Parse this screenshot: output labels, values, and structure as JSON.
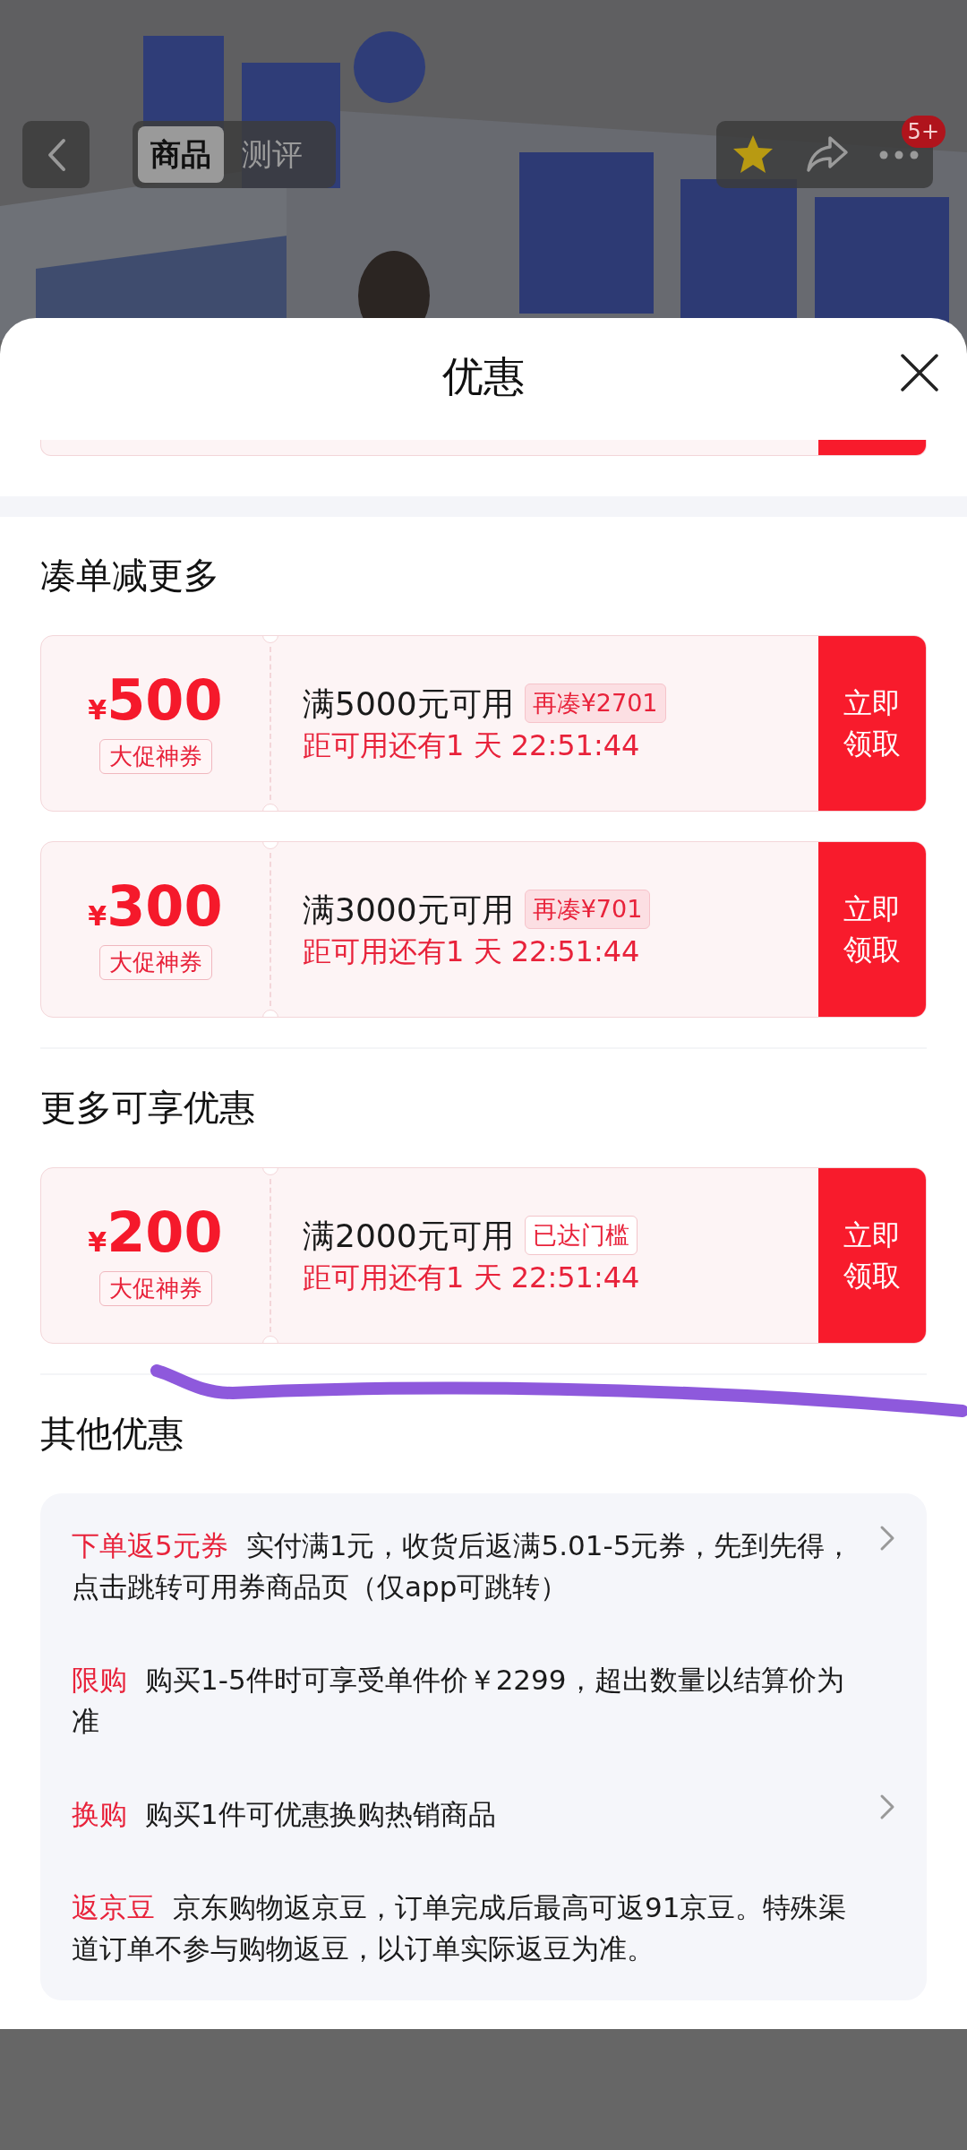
{
  "top_bar": {
    "back": {
      "kind": "back"
    },
    "tabs": [
      {
        "label": "商品",
        "selected": true
      },
      {
        "label": "测评",
        "selected": false
      }
    ],
    "actions": [
      {
        "kind": "star"
      },
      {
        "kind": "share"
      },
      {
        "kind": "more"
      }
    ],
    "badge": "5+"
  },
  "sheet": {
    "title": "优惠",
    "sections": [
      {
        "heading": "凑单减更多",
        "coupons": [
          {
            "currency": "¥",
            "amount": "500",
            "type": "大促神券",
            "condition": "满5000元可用",
            "tag": "再凑¥2701",
            "threshold_met": false,
            "countdown": "距可用还有1 天 22:51:44",
            "button": "立即领取"
          },
          {
            "currency": "¥",
            "amount": "300",
            "type": "大促神券",
            "condition": "满3000元可用",
            "tag": "再凑¥701",
            "threshold_met": false,
            "countdown": "距可用还有1 天 22:51:44",
            "button": "立即领取"
          }
        ]
      },
      {
        "heading": "更多可享优惠",
        "coupons": [
          {
            "currency": "¥",
            "amount": "200",
            "type": "大促神券",
            "condition": "满2000元可用",
            "tag": "已达门槛",
            "threshold_met": true,
            "countdown": "距可用还有1 天 22:51:44",
            "button": "立即领取"
          }
        ]
      }
    ],
    "other": {
      "heading": "其他优惠",
      "items": [
        {
          "label": "下单返5元券",
          "text": "实付满1元，收货后返满5.01-5元券，先到先得，点击跳转可用券商品页（仅app可跳转）",
          "has_link": true
        },
        {
          "label": "限购",
          "text": "购买1-5件时可享受单件价￥2299，超出数量以结算价为准",
          "has_link": false
        },
        {
          "label": "换购",
          "text": "购买1件可优惠换购热销商品",
          "has_link": true
        },
        {
          "label": "返京豆",
          "text": "京东购物返京豆，订单完成后最高可返91京豆。特殊渠道订单不参与购物返豆，以订单实际返豆为准。",
          "has_link": false
        }
      ]
    }
  },
  "scribble": {
    "kind": "freehand-line"
  }
}
